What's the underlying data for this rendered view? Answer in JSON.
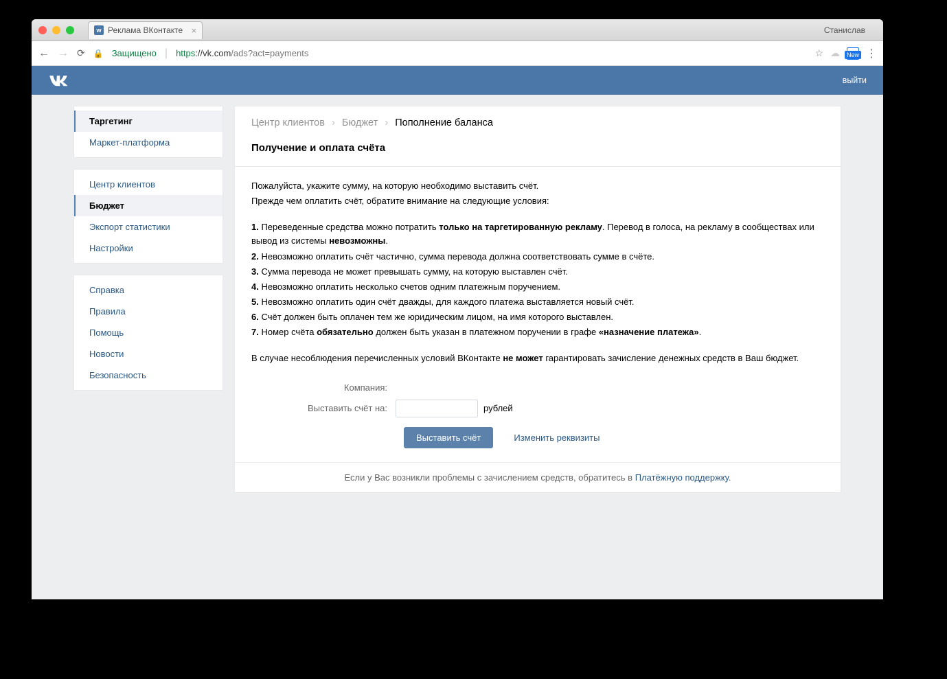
{
  "browser": {
    "tab_title": "Реклама ВКонтакте",
    "profile_name": "Станислав",
    "secure_label": "Защищено",
    "url_proto": "https",
    "url_host": "://vk.com",
    "url_path": "/ads?act=payments"
  },
  "vk_header": {
    "logout": "выйти"
  },
  "sidebar": {
    "block1": [
      {
        "label": "Таргетинг",
        "active": true
      },
      {
        "label": "Маркет-платформа",
        "active": false
      }
    ],
    "block2": [
      {
        "label": "Центр клиентов",
        "active": false
      },
      {
        "label": "Бюджет",
        "active": true
      },
      {
        "label": "Экспорт статистики",
        "active": false
      },
      {
        "label": "Настройки",
        "active": false
      }
    ],
    "block3": [
      {
        "label": "Справка"
      },
      {
        "label": "Правила"
      },
      {
        "label": "Помощь"
      },
      {
        "label": "Новости"
      },
      {
        "label": "Безопасность"
      }
    ]
  },
  "breadcrumb": {
    "l1": "Центр клиентов",
    "l2": "Бюджет",
    "l3": "Пополнение баланса"
  },
  "section_title": "Получение и оплата счёта",
  "intro": {
    "p1": "Пожалуйста, укажите сумму, на которую необходимо выставить счёт.",
    "p2": "Прежде чем оплатить счёт, обратите внимание на следующие условия:"
  },
  "rules": {
    "r1_a": "1.",
    "r1_b": " Переведенные средства можно потратить ",
    "r1_c": "только на таргетированную рекламу",
    "r1_d": ". Перевод в голоса, на рекламу в сообществах или вывод из системы ",
    "r1_e": "невозможны",
    "r1_f": ".",
    "r2_a": "2.",
    "r2_b": " Невозможно оплатить счёт частично, сумма перевода должна соответствовать сумме в счёте.",
    "r3_a": "3.",
    "r3_b": " Сумма перевода не может превышать сумму, на которую выставлен счёт.",
    "r4_a": "4.",
    "r4_b": " Невозможно оплатить несколько счетов одним платежным поручением.",
    "r5_a": "5.",
    "r5_b": " Невозможно оплатить один счёт дважды, для каждого платежа выставляется новый счёт.",
    "r6_a": "6.",
    "r6_b": " Счёт должен быть оплачен тем же юридическим лицом, на имя которого выставлен.",
    "r7_a": "7.",
    "r7_b": " Номер счёта ",
    "r7_c": "обязательно",
    "r7_d": " должен быть указан в платежном поручении в графе ",
    "r7_e": "«назначение платежа»",
    "r7_f": "."
  },
  "warning": {
    "a": "В случае несоблюдения перечисленных условий ВКонтакте ",
    "b": "не может",
    "c": " гарантировать зачисление денежных средств в Ваш бюджет."
  },
  "form": {
    "company_label": "Компания:",
    "invoice_label": "Выставить счёт на:",
    "currency": "рублей",
    "submit": "Выставить счёт",
    "change_link": "Изменить реквизиты"
  },
  "footer": {
    "text": "Если у Вас возникли проблемы с зачислением средств, обратитесь в ",
    "link": "Платёжную поддержку",
    "dot": "."
  }
}
